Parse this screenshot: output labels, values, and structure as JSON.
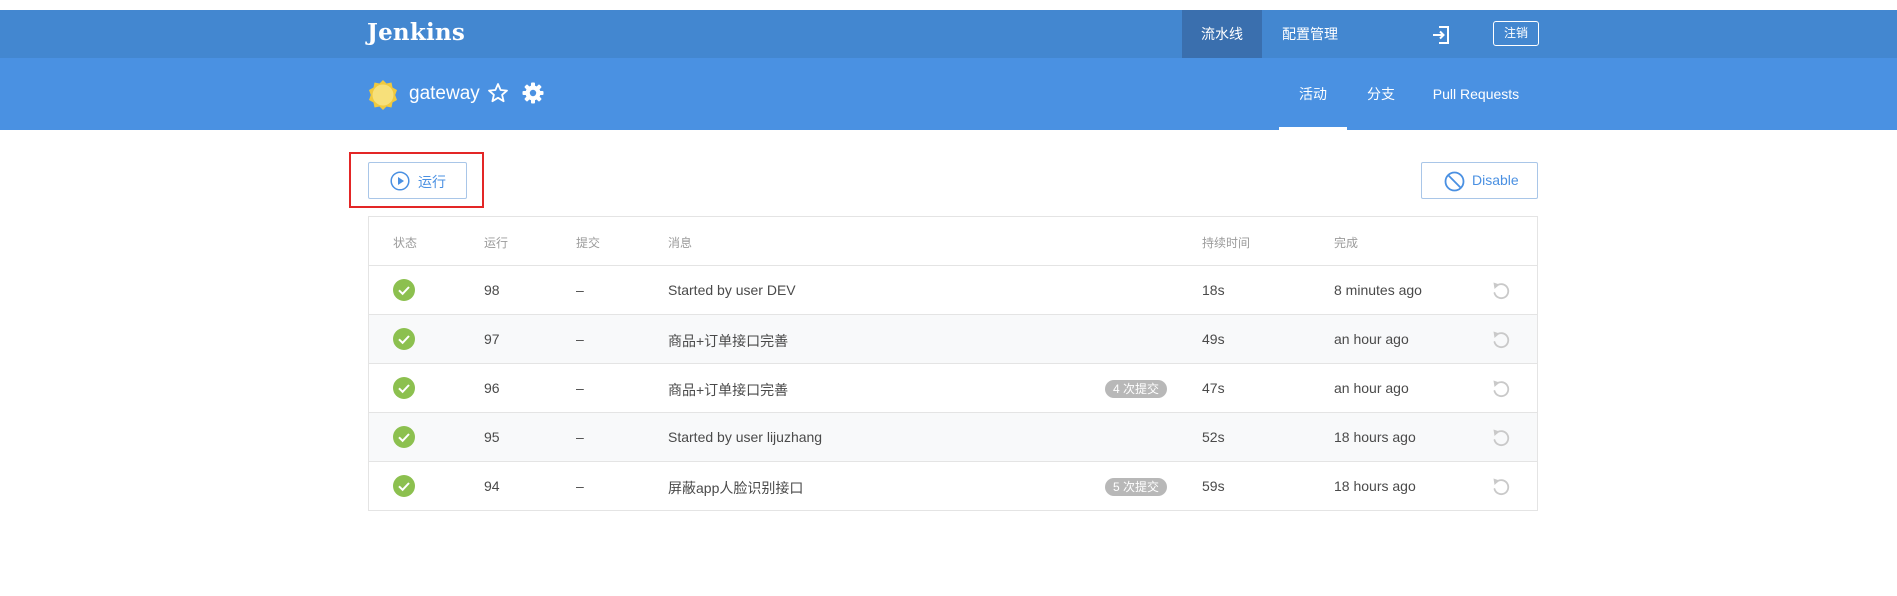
{
  "app": {
    "brand": "Jenkins",
    "nav": {
      "pipelines": "流水线",
      "admin": "配置管理",
      "logout": "注销"
    }
  },
  "job": {
    "name": "gateway",
    "tabs": {
      "activity": "活动",
      "branches": "分支",
      "pull_requests": "Pull Requests"
    }
  },
  "toolbar": {
    "run_label": "运行",
    "disable_label": "Disable"
  },
  "table": {
    "headers": {
      "status": "状态",
      "run": "运行",
      "commit": "提交",
      "message": "消息",
      "duration": "持续时间",
      "completed": "完成"
    },
    "rows": [
      {
        "status": "success",
        "run": "98",
        "commit": "–",
        "message": "Started by user DEV",
        "badge": "",
        "duration": "18s",
        "completed": "8 minutes ago"
      },
      {
        "status": "success",
        "run": "97",
        "commit": "–",
        "message": "商品+订单接口完善",
        "badge": "",
        "duration": "49s",
        "completed": "an hour ago"
      },
      {
        "status": "success",
        "run": "96",
        "commit": "–",
        "message": "商品+订单接口完善",
        "badge": "4 次提交",
        "duration": "47s",
        "completed": "an hour ago"
      },
      {
        "status": "success",
        "run": "95",
        "commit": "–",
        "message": "Started by user lijuzhang",
        "badge": "",
        "duration": "52s",
        "completed": "18 hours ago"
      },
      {
        "status": "success",
        "run": "94",
        "commit": "–",
        "message": "屏蔽app人脸识别接口",
        "badge": "5 次提交",
        "duration": "59s",
        "completed": "18 hours ago"
      }
    ]
  },
  "icons": {
    "job_status": "sun-weather-icon",
    "favorite": "star-outline-icon",
    "settings": "gear-icon",
    "exit": "exit-icon",
    "run": "play-circle-icon",
    "disable": "ban-icon",
    "row_status": "success-check-icon",
    "rerun": "rerun-icon"
  },
  "colors": {
    "topbar": "#4387d0",
    "topbar_active": "#3a6fae",
    "subbar": "#4a91e2",
    "accent": "#4a90e2",
    "success": "#8cc04f",
    "highlight": "#e32626",
    "sun": "#f5d85a"
  }
}
